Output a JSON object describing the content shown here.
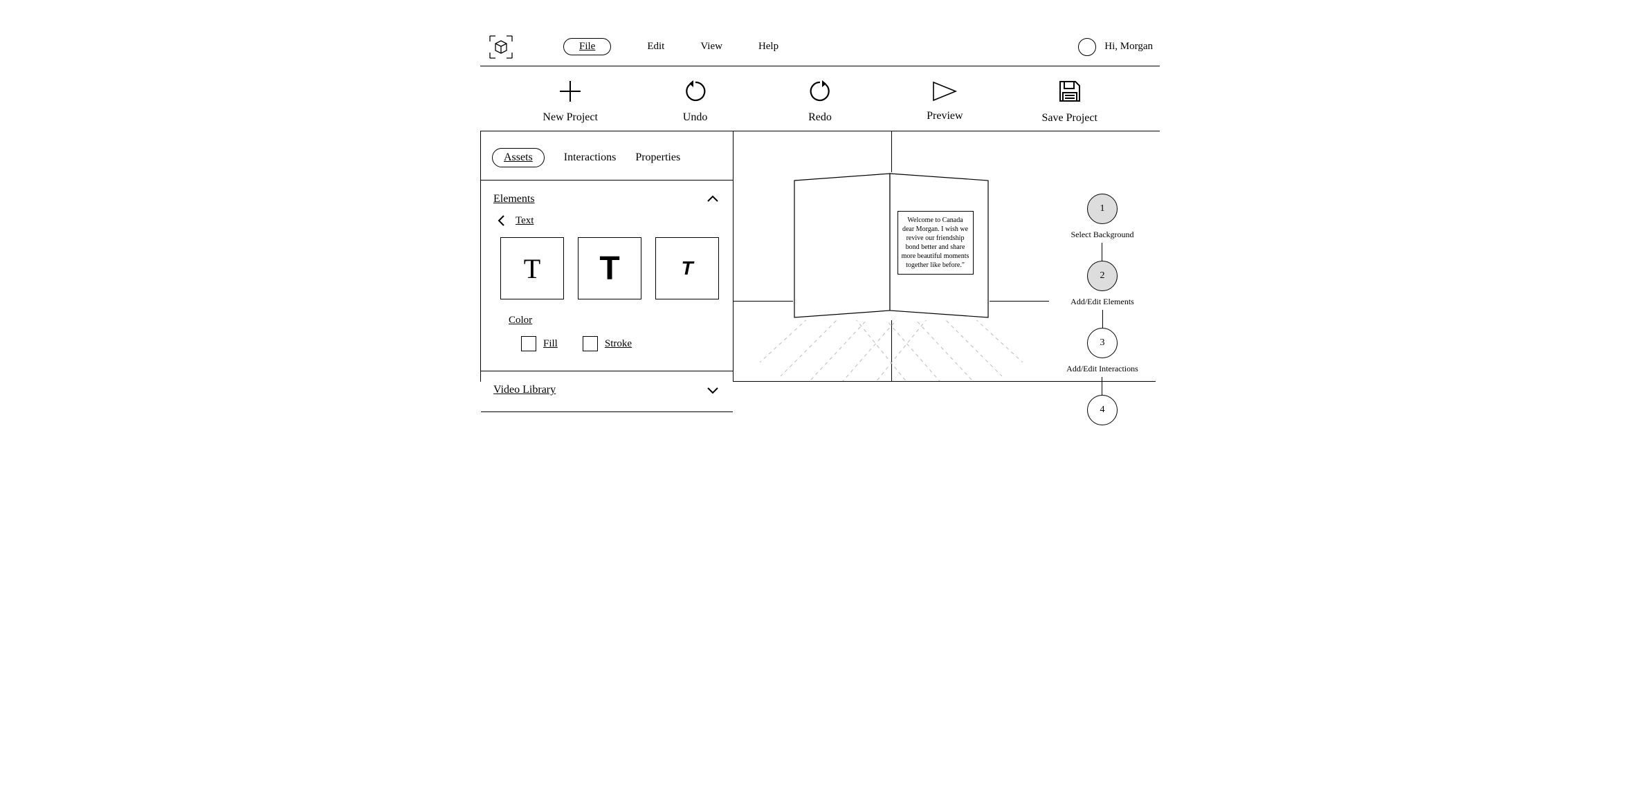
{
  "menubar": {
    "items": [
      "File",
      "Edit",
      "View",
      "Help"
    ],
    "active_index": 0,
    "user_greeting": "Hi, Morgan"
  },
  "toolbar": {
    "items": [
      "New Project",
      "Undo",
      "Redo",
      "Preview",
      "Save Project"
    ]
  },
  "side_panel": {
    "tabs": [
      "Assets",
      "Interactions",
      "Properties"
    ],
    "active_tab_index": 0,
    "elements": {
      "header": "Elements",
      "breadcrumb": "Text",
      "color_label": "Color",
      "fill_label": "Fill",
      "stroke_label": "Stroke"
    },
    "video_library_header": "Video Library"
  },
  "canvas": {
    "card_text": "Welcome to Canada dear Morgan. I wish we revive our friendship bond better and share more beautiful moments together like before.\""
  },
  "stepper": {
    "steps": [
      {
        "num": "1",
        "label": "Select Background",
        "filled": true
      },
      {
        "num": "2",
        "label": "Add/Edit Elements",
        "filled": true
      },
      {
        "num": "3",
        "label": "Add/Edit Interactions",
        "filled": false
      },
      {
        "num": "4",
        "label": "",
        "filled": false
      }
    ]
  }
}
